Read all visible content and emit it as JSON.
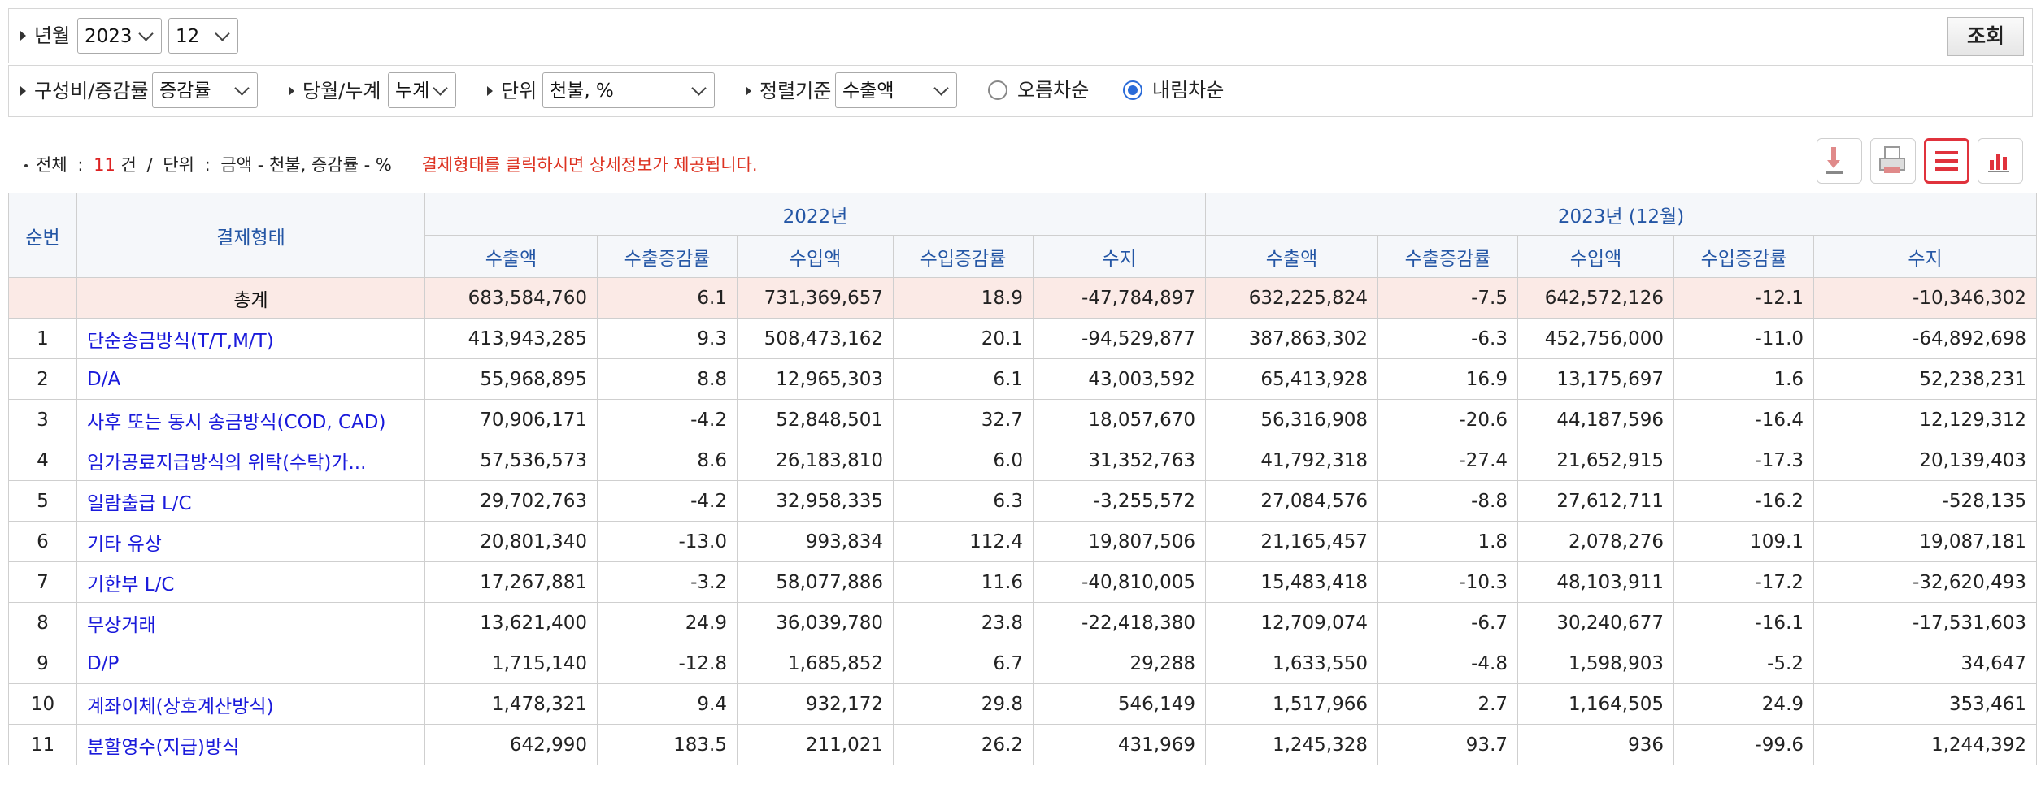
{
  "filters": {
    "period_label": "년월",
    "year_value": "2023",
    "month_value": "12",
    "search_button": "조회",
    "ratio_label": "구성비/증감률",
    "ratio_value": "증감률",
    "period_type_label": "당월/누계",
    "period_type_value": "누계",
    "unit_label": "단위",
    "unit_value": "천불, %",
    "sort_label": "정렬기준",
    "sort_value": "수출액",
    "asc_label": "오름차순",
    "desc_label": "내림차순",
    "selected_order": "내림차순"
  },
  "summary": {
    "total_label": "전체",
    "colon1": ":",
    "count": "11",
    "count_unit": "건",
    "slash": "/",
    "unit_label": "단위",
    "colon2": ":",
    "unit_text": "금액 - 천불, 증감률 - %",
    "notice": "결제형태를 클릭하시면 상세정보가 제공됩니다."
  },
  "toolbar": {
    "icons": [
      "download-icon",
      "print-icon",
      "list-icon",
      "chart-icon"
    ],
    "accent_color": "#e0323c"
  },
  "table": {
    "col_no": "순번",
    "col_type": "결제형태",
    "group1": "2022년",
    "group2": "2023년 (12월)",
    "sub": [
      "수출액",
      "수출증감률",
      "수입액",
      "수입증감률",
      "수지"
    ],
    "total": {
      "name": "총계",
      "values": [
        "683,584,760",
        "6.1",
        "731,369,657",
        "18.9",
        "-47,784,897",
        "632,225,824",
        "-7.5",
        "642,572,126",
        "-12.1",
        "-10,346,302"
      ]
    },
    "rows": [
      {
        "no": "1",
        "name": "단순송금방식(T/T,M/T)",
        "values": [
          "413,943,285",
          "9.3",
          "508,473,162",
          "20.1",
          "-94,529,877",
          "387,863,302",
          "-6.3",
          "452,756,000",
          "-11.0",
          "-64,892,698"
        ]
      },
      {
        "no": "2",
        "name": "D/A",
        "values": [
          "55,968,895",
          "8.8",
          "12,965,303",
          "6.1",
          "43,003,592",
          "65,413,928",
          "16.9",
          "13,175,697",
          "1.6",
          "52,238,231"
        ]
      },
      {
        "no": "3",
        "name": "사후 또는 동시 송금방식(COD, CAD)",
        "values": [
          "70,906,171",
          "-4.2",
          "52,848,501",
          "32.7",
          "18,057,670",
          "56,316,908",
          "-20.6",
          "44,187,596",
          "-16.4",
          "12,129,312"
        ]
      },
      {
        "no": "4",
        "name": "임가공료지급방식의 위탁(수탁)가...",
        "values": [
          "57,536,573",
          "8.6",
          "26,183,810",
          "6.0",
          "31,352,763",
          "41,792,318",
          "-27.4",
          "21,652,915",
          "-17.3",
          "20,139,403"
        ]
      },
      {
        "no": "5",
        "name": "일람출급 L/C",
        "values": [
          "29,702,763",
          "-4.2",
          "32,958,335",
          "6.3",
          "-3,255,572",
          "27,084,576",
          "-8.8",
          "27,612,711",
          "-16.2",
          "-528,135"
        ]
      },
      {
        "no": "6",
        "name": "기타 유상",
        "values": [
          "20,801,340",
          "-13.0",
          "993,834",
          "112.4",
          "19,807,506",
          "21,165,457",
          "1.8",
          "2,078,276",
          "109.1",
          "19,087,181"
        ]
      },
      {
        "no": "7",
        "name": "기한부 L/C",
        "values": [
          "17,267,881",
          "-3.2",
          "58,077,886",
          "11.6",
          "-40,810,005",
          "15,483,418",
          "-10.3",
          "48,103,911",
          "-17.2",
          "-32,620,493"
        ]
      },
      {
        "no": "8",
        "name": "무상거래",
        "values": [
          "13,621,400",
          "24.9",
          "36,039,780",
          "23.8",
          "-22,418,380",
          "12,709,074",
          "-6.7",
          "30,240,677",
          "-16.1",
          "-17,531,603"
        ]
      },
      {
        "no": "9",
        "name": "D/P",
        "values": [
          "1,715,140",
          "-12.8",
          "1,685,852",
          "6.7",
          "29,288",
          "1,633,550",
          "-4.8",
          "1,598,903",
          "-5.2",
          "34,647"
        ]
      },
      {
        "no": "10",
        "name": "계좌이체(상호계산방식)",
        "values": [
          "1,478,321",
          "9.4",
          "932,172",
          "29.8",
          "546,149",
          "1,517,966",
          "2.7",
          "1,164,505",
          "24.9",
          "353,461"
        ]
      },
      {
        "no": "11",
        "name": "분할영수(지급)방식",
        "values": [
          "642,990",
          "183.5",
          "211,021",
          "26.2",
          "431,969",
          "1,245,328",
          "93.7",
          "936",
          "-99.6",
          "1,244,392"
        ]
      }
    ]
  }
}
